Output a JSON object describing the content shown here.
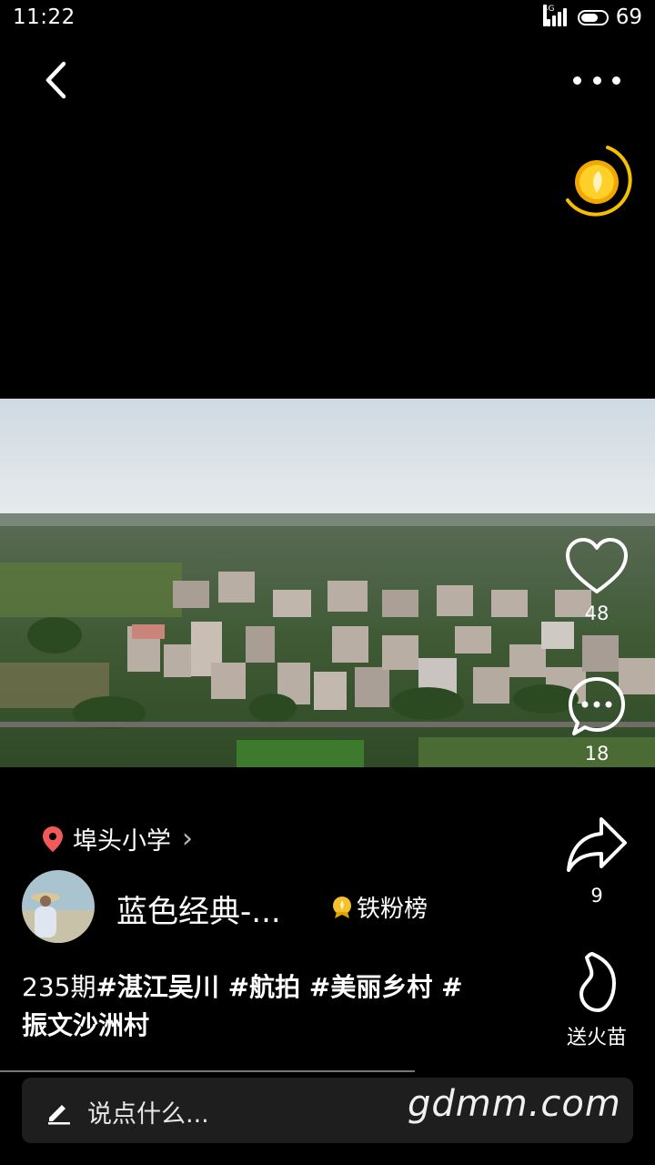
{
  "status_bar": {
    "time": "11:22",
    "network": "4G",
    "battery": "69",
    "battery_level": 0.69
  },
  "video": {
    "alt": "aerial village video"
  },
  "actions": {
    "like_count": "48",
    "comment_count": "18",
    "share_count": "9",
    "gift_label": "送火苗"
  },
  "location": {
    "name": "埠头小学",
    "arrow": "›"
  },
  "author": {
    "name": "蓝色经典-...",
    "badge": "铁粉榜"
  },
  "caption": {
    "issue": "235期",
    "tags_line1": "#湛江吴川 #航拍 #美丽乡村 #",
    "tags_line2": "振文沙洲村"
  },
  "comment_bar": {
    "placeholder": "说点什么..."
  },
  "watermark": "gdmm.com",
  "colors": {
    "background": "#000000",
    "location_pin": "#f25a5a",
    "coin": "#f6c000"
  },
  "icons": [
    "back-icon",
    "more-icon",
    "coin-icon",
    "heart-icon",
    "comment-icon",
    "share-icon",
    "flame-icon",
    "location-pin-icon",
    "chevron-right-icon",
    "medal-icon",
    "pencil-icon"
  ]
}
